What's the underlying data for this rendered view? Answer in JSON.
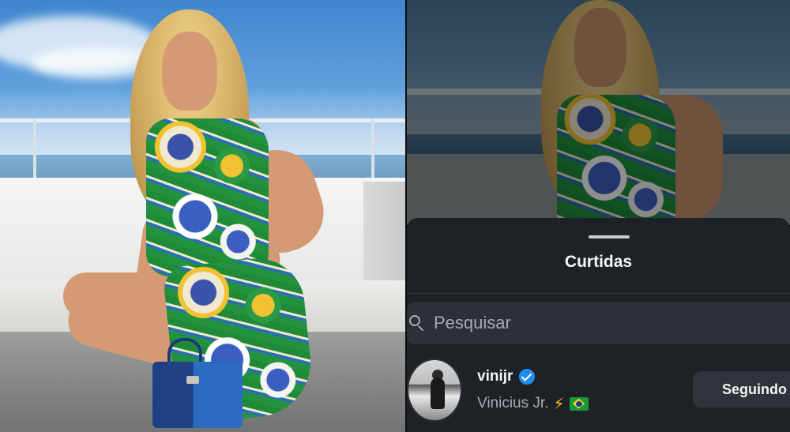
{
  "likes_sheet": {
    "title": "Curtidas",
    "search": {
      "placeholder": "Pesquisar",
      "value": ""
    },
    "users": [
      {
        "username": "vinijr",
        "verified": true,
        "full_name": "Vinicius Jr.",
        "emoji_lightning": "⚡",
        "flag": "brazil-flag-icon",
        "button_label": "Seguindo"
      }
    ]
  },
  "colors": {
    "sheet_background": "#1e2227",
    "search_background": "#2c3137",
    "verified_blue": "#1f8ef1",
    "button_background": "#2e343a"
  },
  "icons": [
    "search-icon",
    "verified-badge-icon",
    "lightning-emoji-icon",
    "brazil-flag-icon"
  ]
}
